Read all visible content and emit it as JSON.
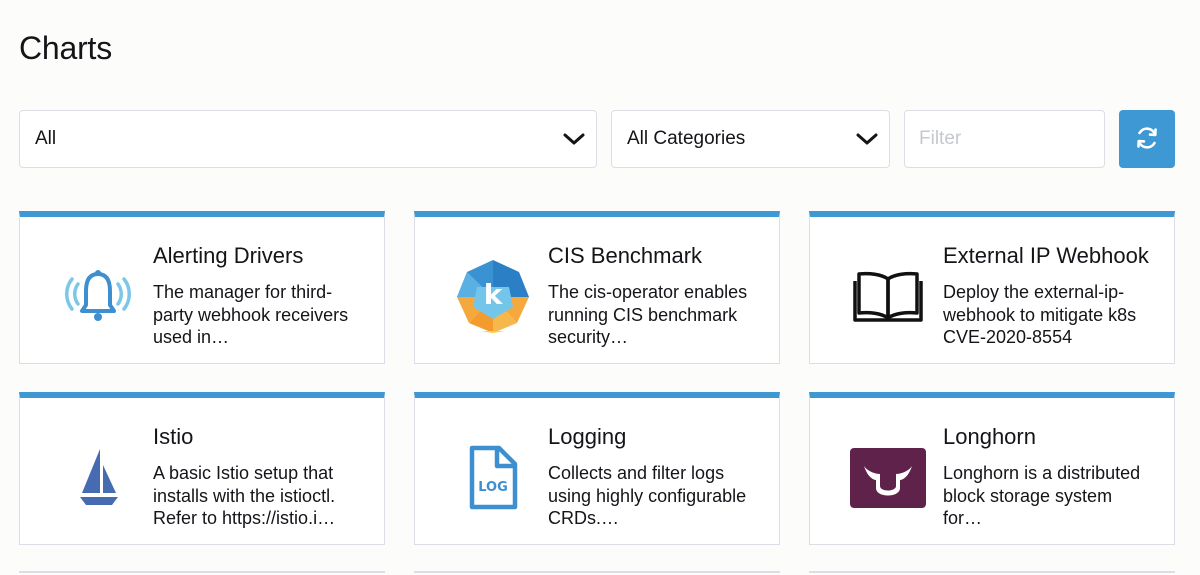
{
  "page": {
    "title": "Charts"
  },
  "filters": {
    "namespace_value": "All",
    "category_value": "All Categories",
    "search_placeholder": "Filter"
  },
  "cards": [
    {
      "name": "Alerting Drivers",
      "description": "The manager for third-party webhook receivers used in…",
      "icon": "bell-icon"
    },
    {
      "name": "CIS Benchmark",
      "description": "The cis-operator enables running CIS benchmark security…",
      "icon": "kubernetes-k-logo"
    },
    {
      "name": "External IP Webhook",
      "description": "Deploy the external-ip-webhook to mitigate k8s CVE-2020-8554",
      "icon": "open-book-icon"
    },
    {
      "name": "Istio",
      "description": "A basic Istio setup that installs with the istioctl. Refer to https://istio.i…",
      "icon": "istio-sail-logo"
    },
    {
      "name": "Logging",
      "description": "Collects and filter logs using highly configurable CRDs.…",
      "icon": "log-file-icon",
      "icon_text": "LOG"
    },
    {
      "name": "Longhorn",
      "description": "Longhorn is a distributed block storage system for…",
      "icon": "longhorn-logo"
    }
  ],
  "colors": {
    "accent": "#3d98d3",
    "border": "#dcdee7",
    "longhorn": "#5f224a"
  }
}
